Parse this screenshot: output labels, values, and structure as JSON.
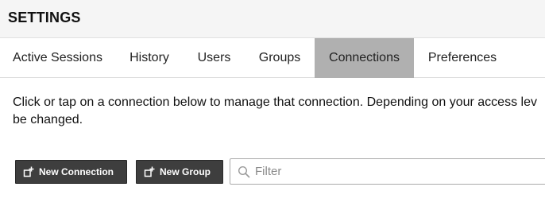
{
  "header": {
    "title": "SETTINGS"
  },
  "tabs": [
    {
      "label": "Active Sessions",
      "active": false
    },
    {
      "label": "History",
      "active": false
    },
    {
      "label": "Users",
      "active": false
    },
    {
      "label": "Groups",
      "active": false
    },
    {
      "label": "Connections",
      "active": true
    },
    {
      "label": "Preferences",
      "active": false
    }
  ],
  "instructions": {
    "line1": "Click or tap on a connection below to manage that connection. Depending on your access lev",
    "line2": "be changed."
  },
  "toolbar": {
    "new_connection_label": "New Connection",
    "new_group_label": "New Group",
    "filter_placeholder": "Filter",
    "filter_value": ""
  },
  "icons": {
    "new_connection": "add-connection-icon",
    "new_group": "add-group-icon",
    "filter": "search-icon"
  },
  "colors": {
    "active_tab": "#b0b0b0",
    "button_bg": "#3e3e3e",
    "header_bg": "#f5f5f5"
  }
}
